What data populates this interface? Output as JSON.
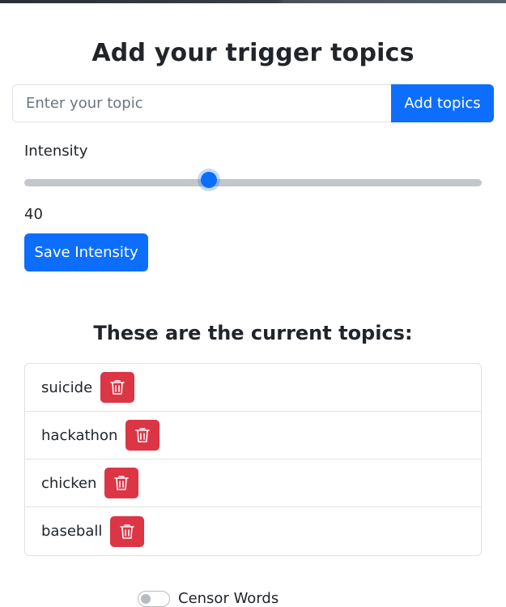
{
  "header": {
    "title": "Add your trigger topics"
  },
  "topic_form": {
    "placeholder": "Enter your topic",
    "value": "",
    "add_label": "Add topics"
  },
  "intensity": {
    "label": "Intensity",
    "value": 40,
    "min": 0,
    "max": 100,
    "display": "40",
    "save_label": "Save Intensity"
  },
  "topics_section": {
    "heading": "These are the current topics:",
    "items": [
      {
        "label": "suicide",
        "delete_icon": "trash-icon"
      },
      {
        "label": "hackathon",
        "delete_icon": "trash-icon"
      },
      {
        "label": "chicken",
        "delete_icon": "trash-icon"
      },
      {
        "label": "baseball",
        "delete_icon": "trash-icon"
      }
    ]
  },
  "toggle": {
    "label": "Censor Words",
    "on": false
  },
  "colors": {
    "primary": "#0d6efd",
    "danger": "#dc3545",
    "border": "#dee2e6",
    "text": "#212529"
  }
}
